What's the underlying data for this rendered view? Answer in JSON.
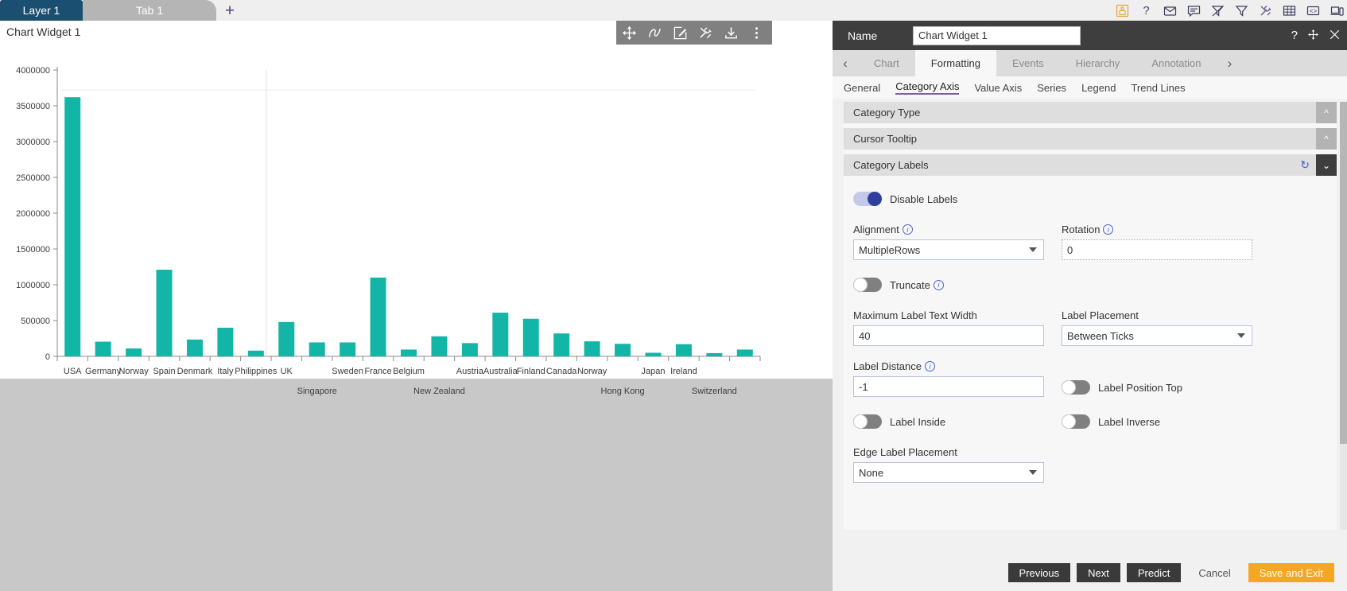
{
  "topbar": {
    "layer_tab": "Layer 1",
    "sheet_tab": "Tab 1",
    "add_tab": "+",
    "icons": [
      "save-icon",
      "help-icon",
      "mail-icon",
      "comment-icon",
      "clear-filter-icon",
      "filter-icon",
      "tools-icon",
      "grid-icon",
      "code-icon",
      "device-icon"
    ]
  },
  "chart_widget": {
    "title": "Chart Widget 1",
    "tools": [
      "move-icon",
      "freehand-icon",
      "edit-icon",
      "settings-icon",
      "download-icon",
      "more-icon"
    ]
  },
  "chart_data": {
    "type": "bar",
    "title": "",
    "xlabel": "",
    "ylabel": "",
    "ylim": [
      0,
      4000000
    ],
    "ytick_labels": [
      "0",
      "500000",
      "1000000",
      "1500000",
      "2000000",
      "2500000",
      "3000000",
      "3500000",
      "4000000"
    ],
    "yticks": [
      0,
      500000,
      1000000,
      1500000,
      2000000,
      2500000,
      3000000,
      3500000,
      4000000
    ],
    "grid": false,
    "legend": false,
    "bar_color": "#13b5a6",
    "label_alignment": "MultipleRows",
    "categories": [
      "USA",
      "Germany",
      "Norway",
      "Spain",
      "Denmark",
      "Italy",
      "Philippines",
      "UK",
      "Singapore",
      "Sweden",
      "France",
      "Belgium",
      "New Zealand",
      "Austria",
      "Australia",
      "Finland",
      "Canada",
      "Norway",
      "Hong Kong",
      "Japan",
      "Ireland",
      "Switzerland"
    ],
    "values": [
      3620000,
      205000,
      110000,
      1210000,
      235000,
      400000,
      80000,
      480000,
      195000,
      195000,
      1100000,
      95000,
      280000,
      185000,
      610000,
      525000,
      320000,
      210000,
      175000,
      50000,
      170000,
      45000,
      95000
    ]
  },
  "side_panel": {
    "header": {
      "name_label": "Name",
      "name_value": "Chart Widget 1",
      "help_icon": "?",
      "move_icon": "move-icon",
      "close_icon": "close-icon"
    },
    "tabs": [
      {
        "label": "Chart",
        "active": false
      },
      {
        "label": "Formatting",
        "active": true
      },
      {
        "label": "Events",
        "active": false
      },
      {
        "label": "Hierarchy",
        "active": false
      },
      {
        "label": "Annotation",
        "active": false
      }
    ],
    "subtabs": [
      {
        "label": "General",
        "active": false
      },
      {
        "label": "Category Axis",
        "active": true
      },
      {
        "label": "Value Axis",
        "active": false
      },
      {
        "label": "Series",
        "active": false
      },
      {
        "label": "Legend",
        "active": false
      },
      {
        "label": "Trend Lines",
        "active": false
      }
    ],
    "accordions": [
      {
        "title": "Category Type",
        "state": "collapsed"
      },
      {
        "title": "Cursor Tooltip",
        "state": "collapsed"
      },
      {
        "title": "Category Labels",
        "state": "expanded"
      }
    ],
    "category_labels": {
      "disable_labels": {
        "label": "Disable Labels",
        "on": true
      },
      "alignment": {
        "label": "Alignment",
        "value": "MultipleRows"
      },
      "rotation": {
        "label": "Rotation",
        "value": "0"
      },
      "truncate": {
        "label": "Truncate",
        "on": false
      },
      "max_label_text_width": {
        "label": "Maximum Label Text Width",
        "value": "40"
      },
      "label_placement": {
        "label": "Label Placement",
        "value": "Between Ticks"
      },
      "label_distance": {
        "label": "Label Distance",
        "value": "-1"
      },
      "label_position_top": {
        "label": "Label Position Top",
        "on": false
      },
      "label_inside": {
        "label": "Label Inside",
        "on": false
      },
      "label_inverse": {
        "label": "Label Inverse",
        "on": false
      },
      "edge_label_placement": {
        "label": "Edge Label Placement",
        "value": "None"
      }
    },
    "footer": {
      "previous": "Previous",
      "next": "Next",
      "predict": "Predict",
      "cancel": "Cancel",
      "save_and_exit": "Save and Exit"
    }
  }
}
